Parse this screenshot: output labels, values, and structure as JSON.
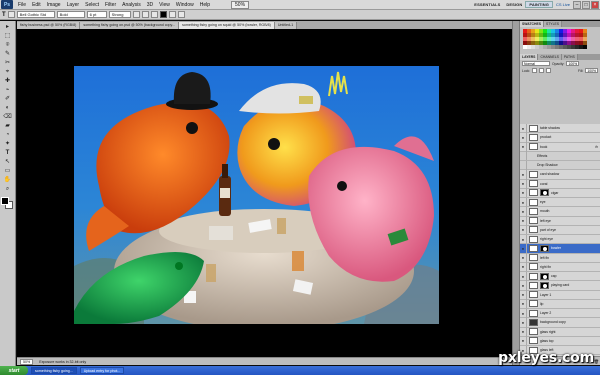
{
  "app": {
    "logo": "Ps",
    "menu": [
      "File",
      "Edit",
      "Image",
      "Layer",
      "Select",
      "Filter",
      "Analysis",
      "3D",
      "View",
      "Window",
      "Help"
    ],
    "zoom": "50%",
    "workspaces": [
      "ESSENTIALS",
      "DESIGN",
      "PAINTING"
    ],
    "active_workspace": "PAINTING",
    "cs_live": "CS Live"
  },
  "options": {
    "font_family": "Bell Gothic Std",
    "font_style": "Bold",
    "font_size": "6 pt",
    "antialias": "Strong"
  },
  "tabs": [
    "fishy business.psd @ 50% (RGB/8)",
    "something fishy going on.psd @ 50% (background copy...",
    "something fishy going on squid @ 50% (bowler, RGB/8)",
    "Untitled-1"
  ],
  "active_tab": 2,
  "tools": [
    "▸",
    "⬚",
    "⌾",
    "✎",
    "✂",
    "⌖",
    "✚",
    "⌁",
    "✐",
    "◐",
    "⌫",
    "▰",
    "◔",
    "✦",
    "T",
    "↖",
    "▭",
    "✋",
    "⌕"
  ],
  "status": {
    "zoom": "50%",
    "info": "Exposure works in 32-bit only"
  },
  "panels": {
    "top_tabs": [
      "SWATCHES",
      "STYLES"
    ],
    "layer_tabs": [
      "LAYERS",
      "CHANNELS",
      "PATHS"
    ],
    "blend_mode": "Normal",
    "opacity_label": "Opacity:",
    "opacity": "100%",
    "lock_label": "Lock:",
    "fill_label": "Fill:",
    "fill": "100%"
  },
  "layers": [
    {
      "name": "table shadow",
      "kind": "plain"
    },
    {
      "name": "product",
      "kind": "plain"
    },
    {
      "name": "book",
      "kind": "plain",
      "fx": "fx"
    },
    {
      "name": "Effects",
      "kind": "sub"
    },
    {
      "name": "Drop Shadow",
      "kind": "sub"
    },
    {
      "name": "card shadow",
      "kind": "plain"
    },
    {
      "name": "coral",
      "kind": "plain"
    },
    {
      "name": "cigar",
      "kind": "mask"
    },
    {
      "name": "eye",
      "kind": "plain"
    },
    {
      "name": "mouth",
      "kind": "plain"
    },
    {
      "name": "left eye",
      "kind": "plain"
    },
    {
      "name": "part of eye",
      "kind": "plain"
    },
    {
      "name": "right eye",
      "kind": "plain"
    },
    {
      "name": "bowler",
      "kind": "mask",
      "selected": true
    },
    {
      "name": "left fin",
      "kind": "plain"
    },
    {
      "name": "right fin",
      "kind": "plain"
    },
    {
      "name": "cap",
      "kind": "mask"
    },
    {
      "name": "playing card",
      "kind": "mask"
    },
    {
      "name": "Layer 1",
      "kind": "plain"
    },
    {
      "name": "lip",
      "kind": "plain"
    },
    {
      "name": "Layer 2",
      "kind": "plain"
    },
    {
      "name": "background copy",
      "kind": "dark"
    },
    {
      "name": "glass right",
      "kind": "plain"
    },
    {
      "name": "glass top",
      "kind": "plain"
    },
    {
      "name": "glass left",
      "kind": "plain"
    }
  ],
  "taskbar": {
    "start": "start",
    "tasks": [
      "something fishy going...",
      "Upload entry for phot..."
    ]
  },
  "watermark": "pxleyes.com",
  "colors": {
    "menubar": "#d9d9d9",
    "panel": "#c2c2c2",
    "selected_layer": "#3a6bc8",
    "taskbar": "#2455c3",
    "canvas_bg": "#000000"
  }
}
